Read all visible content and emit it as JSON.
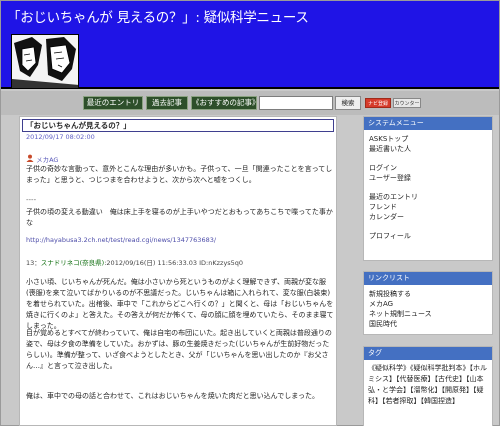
{
  "site": {
    "title": "「おじいちゃんが 見えるの？」: 疑似科学ニュース"
  },
  "nav": {
    "recent": "最近のエントリ",
    "archive": "過去記事",
    "recommend": "おすすめの記事",
    "search_label": "検索",
    "badge_new": "ナビ登録",
    "badge_count": "カウンター"
  },
  "post": {
    "title": "「おじいちゃんが見えるの？」",
    "date": "2012/09/17 08:02:00",
    "author": "メカAG",
    "para1": "子供の奇妙な言動って、意外とこんな理由が多いかも。子供って、一旦「関連ったことを言ってしまった」と思うと、つじつまを合わせようと、次から次へと嘘をつくし。",
    "separator": "----",
    "para2": "子供の頃の変える動違い　俺は床上手を寝るのが上手いやつだとおもってあちこちで喋ってた事かな",
    "link": "http://hayabusa3.2ch.net/test/read.cgi/news/1347763683/",
    "res_num": "13：",
    "res_name": "スナドリネコ(奈良県)",
    "res_meta": ":2012/09/16(日) 11:56:33.03 ID:nKzzys5q0",
    "para3": "小さい頃、じいちゃんが死んだ。俺は小さいから死というものがよく理解できず、両親が変な服(喪服)を来て泣いてばかりいるのが不思議だった。じいちゃんは箱に入れられて、変な服(白装束)を着せられていた。出棺後、車中で「これからどこへ行くの？」と聞くと、母は「おじいちゃんを焼きに行くのよ」と答えた。その答えが何だか怖くて、母の顔に顔を埋めていたら、そのまま寝てしまった。",
    "para4": "目が覚めるとすべてが終わっていて、俺は自宅の布団にいた。起き出していくと両親は普段通りの姿で、母は夕食の準備をしていた。おかずは、豚の生姜焼きだった(じいちゃんが生前好物だったらしい)。準備が整って、いざ食べようとしたとき、父が「じいちゃんを思い出したのか『お父さん…』と言って泣き出した。",
    "para5": "俺は、車中での母の話と合わせて、これはおじいちゃんを焼いた肉だと思い込んでしまった。"
  },
  "sidebar": {
    "menu_title": "システムメニュー",
    "menu_items": [
      "ASKSトップ",
      "最近書いた人",
      "",
      "ログイン",
      "ユーザー登録",
      "",
      "最近のエントリ",
      "フレンド",
      "カレンダー",
      "",
      "プロフィール"
    ],
    "links_title": "リンクリスト",
    "links": [
      "新規投稿する",
      "メカAG",
      "ネット規制ニュース",
      "国民時代"
    ],
    "tag_title": "タグ",
    "tags": "《疑似科学》《疑似科学批判本》【ホルミシス】【代替医療】【古代史】【山本弘・と学会】【溜幣化】【開原発】【疑科】【若者搾取】【韓国捏造】"
  },
  "colors": {
    "banner": "#1f14e6",
    "nav_button": "#2d4f2a",
    "side_head": "#4470c2"
  }
}
